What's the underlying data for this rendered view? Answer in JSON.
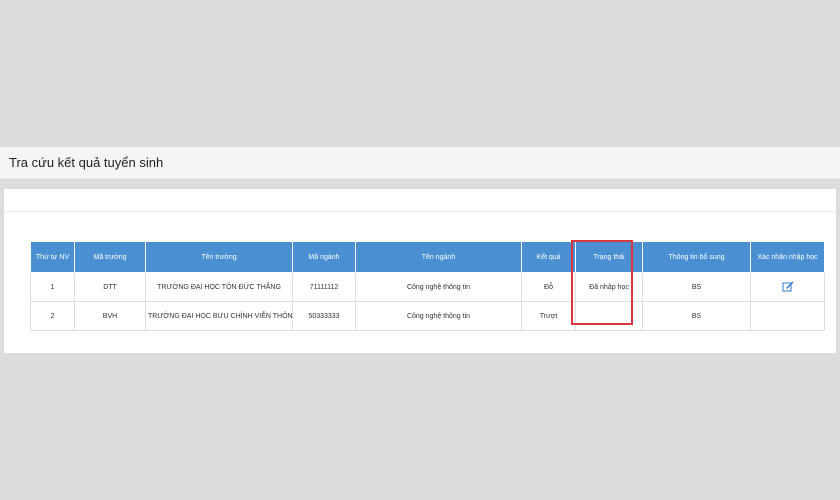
{
  "header": {
    "title": "Tra cứu kết quả tuyển sinh"
  },
  "table": {
    "columns": [
      "Thứ tự NV",
      "Mã trường",
      "Tên trường",
      "Mã ngành",
      "Tên ngành",
      "Kết quả",
      "Trạng thái",
      "Thông tin bổ sung",
      "Xác nhận nhập học"
    ],
    "rows": [
      {
        "order": "1",
        "school_code": "DTT",
        "school_name": "TRƯỜNG ĐẠI HỌC TÔN ĐỨC THẮNG",
        "major_code": "71111112",
        "major_name": "Công nghệ thông tin",
        "result": "Đỗ",
        "status": "Đã nhập học",
        "extra": "BS",
        "confirm_icon": "edit-icon"
      },
      {
        "order": "2",
        "school_code": "BVH",
        "school_name": "TRƯỜNG ĐẠI HỌC BƯU CHÍNH VIỄN THÔNG",
        "major_code": "50333333",
        "major_name": "Công nghệ thông tin",
        "result": "Trượt",
        "status": "",
        "extra": "BS",
        "confirm_icon": ""
      }
    ]
  },
  "colors": {
    "header_bg": "#4a8fd1",
    "highlight": "#d9363e",
    "icon": "#2b7bd0"
  }
}
